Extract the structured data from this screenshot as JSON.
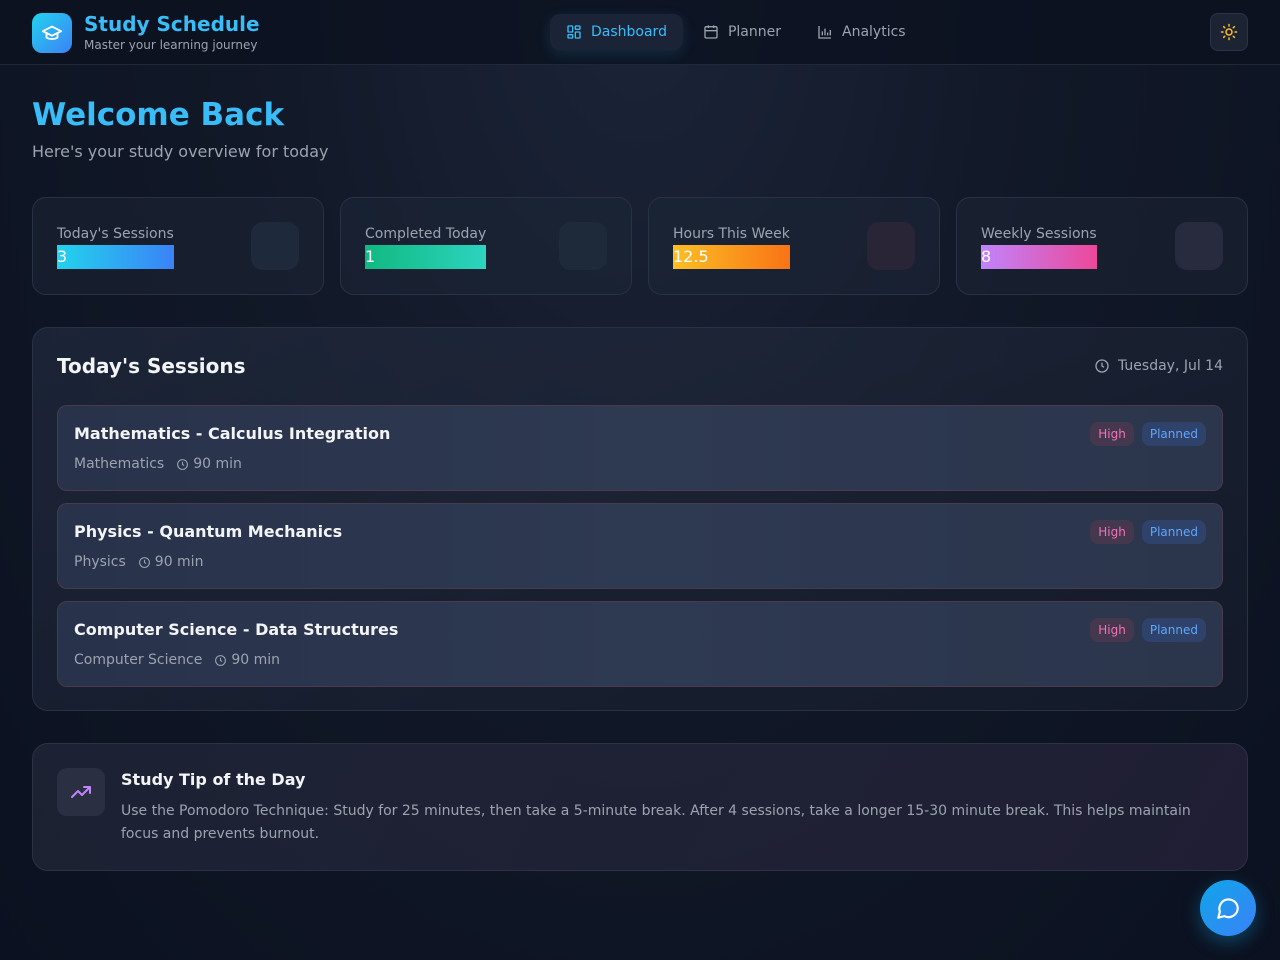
{
  "app": {
    "title": "Study Schedule",
    "subtitle": "Master your learning journey"
  },
  "nav": {
    "items": [
      {
        "label": "Dashboard",
        "icon": "dashboard-grid-icon",
        "active": true
      },
      {
        "label": "Planner",
        "icon": "calendar-icon",
        "active": false
      },
      {
        "label": "Analytics",
        "icon": "bar-chart-icon",
        "active": false
      }
    ],
    "theme_toggle_icon": "sun-icon"
  },
  "welcome": {
    "title": "Welcome Back",
    "subtitle": "Here's your study overview for today"
  },
  "stats": [
    {
      "label": "Today's Sessions",
      "value": "3",
      "gradient": [
        "#22d3ee",
        "#3b82f6"
      ]
    },
    {
      "label": "Completed Today",
      "value": "1",
      "gradient": [
        "#10b981",
        "#2dd4bf"
      ]
    },
    {
      "label": "Hours This Week",
      "value": "12.5",
      "gradient": [
        "#fbbf24",
        "#f97316"
      ]
    },
    {
      "label": "Weekly Sessions",
      "value": "8",
      "gradient": [
        "#c084fc",
        "#ec4899"
      ]
    }
  ],
  "sessions_panel": {
    "title": "Today's Sessions",
    "date": "Tuesday, Jul 14",
    "sessions": [
      {
        "title": "Mathematics - Calculus Integration",
        "subject": "Mathematics",
        "duration": "90 min",
        "priority": "High",
        "status": "Planned"
      },
      {
        "title": "Physics - Quantum Mechanics",
        "subject": "Physics",
        "duration": "90 min",
        "priority": "High",
        "status": "Planned"
      },
      {
        "title": "Computer Science - Data Structures",
        "subject": "Computer Science",
        "duration": "90 min",
        "priority": "High",
        "status": "Planned"
      }
    ]
  },
  "tip": {
    "title": "Study Tip of the Day",
    "text": "Use the Pomodoro Technique: Study for 25 minutes, then take a 5-minute break. After 4 sessions, take a longer 15-30 minute break. This helps maintain focus and prevents burnout.",
    "icon": "trending-up-icon"
  },
  "colors": {
    "accent": "#38bdf8",
    "priority_high": "#f472b6",
    "status_planned": "#60a5fa"
  }
}
